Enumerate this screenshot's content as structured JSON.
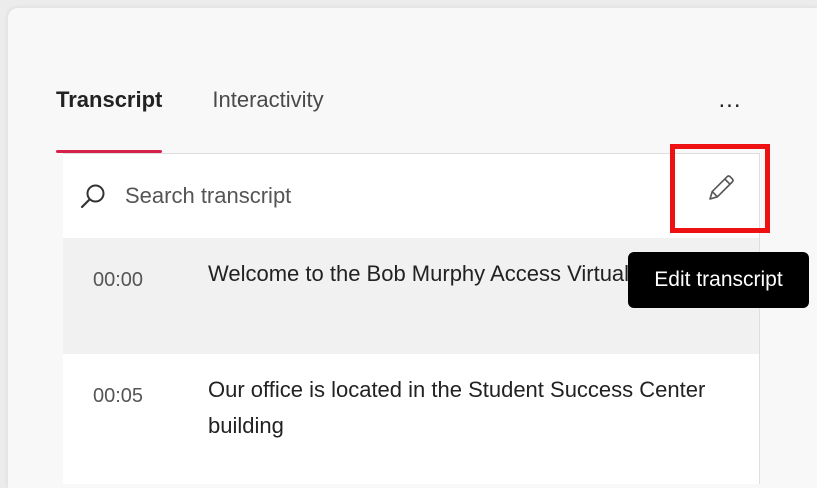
{
  "tabs": [
    {
      "label": "Transcript",
      "active": true
    },
    {
      "label": "Interactivity",
      "active": false
    }
  ],
  "more_options": {
    "icon": "more-horizontal-icon",
    "label": "..."
  },
  "search": {
    "placeholder": "Search transcript",
    "value": "",
    "icon": "search-icon"
  },
  "edit": {
    "icon": "pencil-icon",
    "tooltip": "Edit transcript",
    "highlight_color": "#ee1111"
  },
  "entries": [
    {
      "time": "00:00",
      "text": "Welcome to the Bob Murphy Access Virtual Tour."
    },
    {
      "time": "00:05",
      "text": "Our office is located in the Student Success Center building"
    }
  ],
  "colors": {
    "accent": "#d6204a",
    "tooltip_bg": "#000000"
  }
}
